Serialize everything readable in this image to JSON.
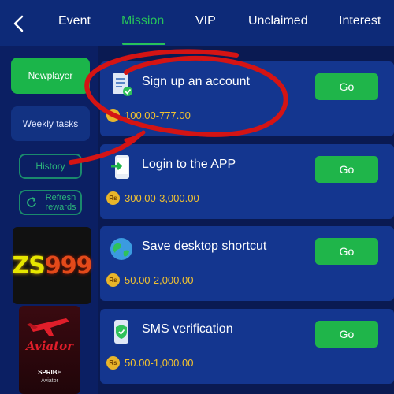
{
  "header": {
    "tabs": [
      {
        "label": "Event"
      },
      {
        "label": "Mission"
      },
      {
        "label": "VIP"
      },
      {
        "label": "Unclaimed"
      },
      {
        "label": "Interest"
      }
    ],
    "active_tab": "Mission"
  },
  "sidebar": {
    "newplayer": "Newplayer",
    "weekly": "Weekly tasks",
    "history": "History",
    "refresh_line1": "Refresh",
    "refresh_line2": "rewards"
  },
  "promos": {
    "zs_part1": "ZS",
    "zs_part2": "999",
    "aviator": "Aviator",
    "spribe": "SPRIBE",
    "aviator_small": "Aviator"
  },
  "tasks": [
    {
      "title": "Sign up an account",
      "reward": "100.00-777.00",
      "button": "Go",
      "icon": "document-check-icon"
    },
    {
      "title": "Login to the APP",
      "reward": "300.00-3,000.00",
      "button": "Go",
      "icon": "phone-login-icon"
    },
    {
      "title": "Save desktop shortcut",
      "reward": "50.00-2,000.00",
      "button": "Go",
      "icon": "globe-icon"
    },
    {
      "title": "SMS verification",
      "reward": "50.00-1,000.00",
      "button": "Go",
      "icon": "shield-icon"
    }
  ],
  "currency_symbol": "Rs",
  "colors": {
    "accent_green": "#1fb54a",
    "reward_gold": "#f2c230",
    "background": "#0a1a52",
    "card": "#14368f",
    "annotation_red": "#d41414"
  }
}
